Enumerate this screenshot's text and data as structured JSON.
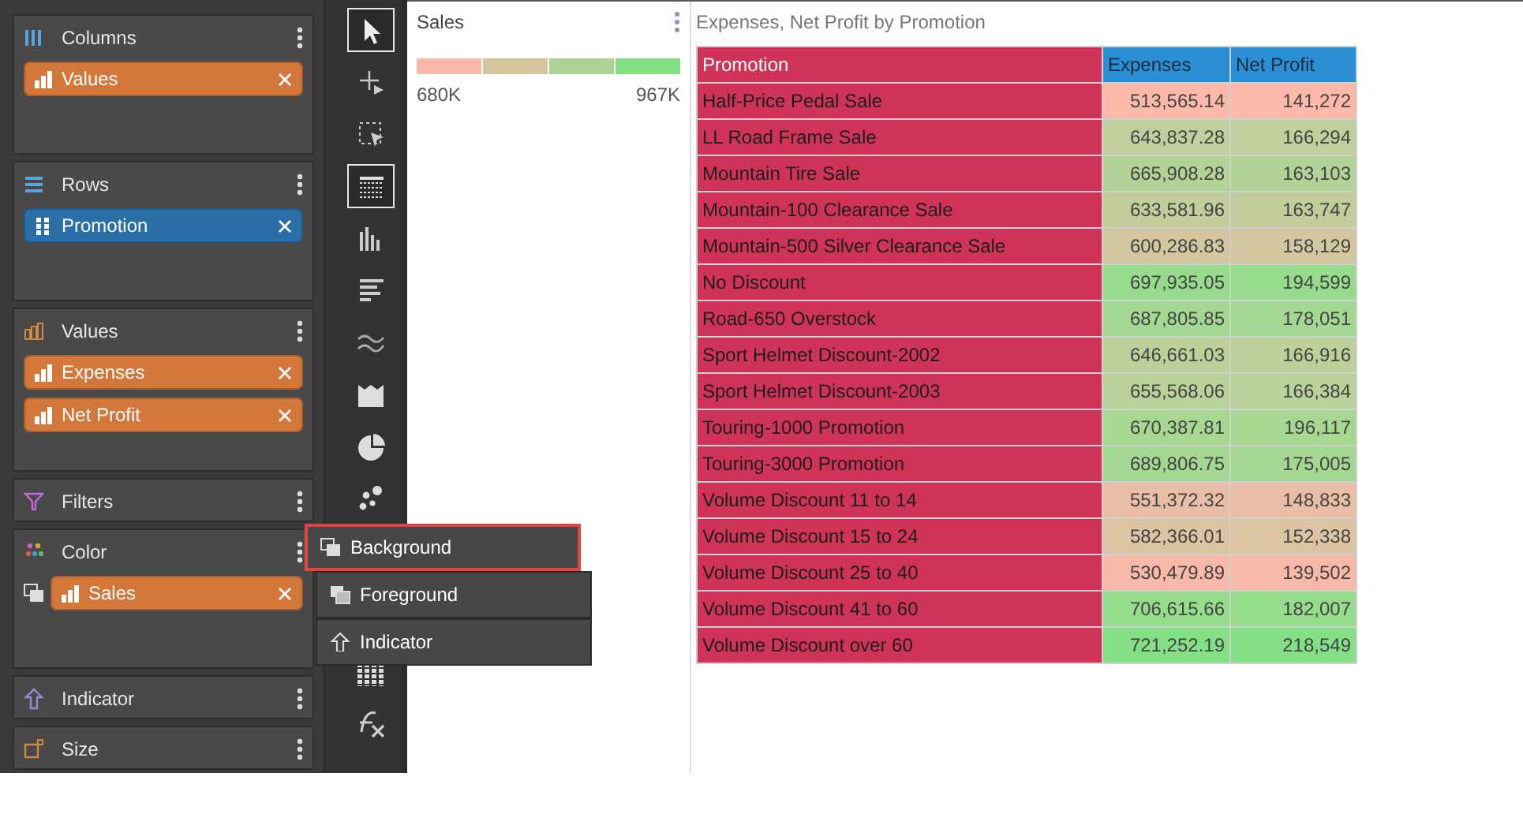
{
  "field_panels": [
    {
      "kind": "columns",
      "title": "Columns",
      "chips": [
        {
          "label": "Values",
          "color": "#d4773a",
          "kind": "measure"
        }
      ]
    },
    {
      "kind": "rows",
      "title": "Rows",
      "chips": [
        {
          "label": "Promotion",
          "color": "#2a6fa8",
          "kind": "dimension"
        }
      ]
    },
    {
      "kind": "values",
      "title": "Values",
      "chips": [
        {
          "label": "Expenses",
          "color": "#d4773a",
          "kind": "measure"
        },
        {
          "label": "Net Profit",
          "color": "#d4773a",
          "kind": "measure"
        }
      ]
    },
    {
      "kind": "filters",
      "title": "Filters"
    },
    {
      "kind": "color",
      "title": "Color",
      "chips": [
        {
          "label": "Sales",
          "color": "#d4773a",
          "kind": "measure"
        }
      ]
    },
    {
      "kind": "indicator",
      "title": "Indicator"
    },
    {
      "kind": "size",
      "title": "Size"
    }
  ],
  "toolbar": [
    {
      "kind": "pointer",
      "selected": true
    },
    {
      "kind": "add",
      "selected": false
    },
    {
      "kind": "select",
      "selected": false
    },
    {
      "kind": "table",
      "selected": true
    },
    {
      "kind": "columns",
      "selected": false
    },
    {
      "kind": "bars",
      "selected": false
    },
    {
      "kind": "line",
      "selected": false
    },
    {
      "kind": "area",
      "selected": false
    },
    {
      "kind": "pie",
      "selected": false
    },
    {
      "kind": "scatter",
      "selected": false
    },
    {
      "kind": "grid",
      "selected": false
    },
    {
      "kind": "formula",
      "selected": false
    }
  ],
  "color_menu": [
    {
      "kind": "background",
      "label": "Background",
      "selected": true
    },
    {
      "kind": "foreground",
      "label": "Foreground",
      "selected": false
    },
    {
      "kind": "indicator",
      "label": "Indicator",
      "selected": false
    }
  ],
  "legend": {
    "title": "Sales",
    "segments": [
      {
        "color": "#fbb8a8"
      },
      {
        "color": "#d5c59e"
      },
      {
        "color": "#acd295"
      },
      {
        "color": "#84df83"
      }
    ],
    "min": "680K",
    "max": "967K"
  },
  "table": {
    "title": "Expenses, Net Profit by Promotion",
    "columns": [
      "Promotion",
      "Expenses",
      "Net Profit"
    ],
    "rows": [
      {
        "cells": [
          "Half-Price Pedal Sale",
          "513,565.14",
          "141,272"
        ],
        "color": "#fcb8a8"
      },
      {
        "cells": [
          "LL Road Frame Sale",
          "643,837.28",
          "166,294"
        ],
        "color": "#c0cf9c"
      },
      {
        "cells": [
          "Mountain Tire Sale",
          "665,908.28",
          "163,103"
        ],
        "color": "#b3d297"
      },
      {
        "cells": [
          "Mountain-100 Clearance Sale",
          "633,581.96",
          "163,747"
        ],
        "color": "#c3cc9b"
      },
      {
        "cells": [
          "Mountain-500 Silver Clearance Sale",
          "600,286.83",
          "158,129"
        ],
        "color": "#d2c79e"
      },
      {
        "cells": [
          "No Discount",
          "697,935.05",
          "194,599"
        ],
        "color": "#97dc8c"
      },
      {
        "cells": [
          "Road-650 Overstock",
          "687,805.85",
          "178,051"
        ],
        "color": "#a2d891"
      },
      {
        "cells": [
          "Sport Helmet Discount-2002",
          "646,661.03",
          "166,916"
        ],
        "color": "#bcd09a"
      },
      {
        "cells": [
          "Sport Helmet Discount-2003",
          "655,568.06",
          "166,384"
        ],
        "color": "#b8d29a"
      },
      {
        "cells": [
          "Touring-1000 Promotion",
          "670,387.81",
          "196,117"
        ],
        "color": "#a6d892"
      },
      {
        "cells": [
          "Touring-3000 Promotion",
          "689,806.75",
          "175,005"
        ],
        "color": "#a3d892"
      },
      {
        "cells": [
          "Volume Discount 11 to 14",
          "551,372.32",
          "148,833"
        ],
        "color": "#eabda6"
      },
      {
        "cells": [
          "Volume Discount 15 to 24",
          "582,366.01",
          "152,338"
        ],
        "color": "#dcc3a2"
      },
      {
        "cells": [
          "Volume Discount 25 to 40",
          "530,479.89",
          "139,502"
        ],
        "color": "#f7b9a8"
      },
      {
        "cells": [
          "Volume Discount 41 to 60",
          "706,615.66",
          "182,007"
        ],
        "color": "#95dc8b"
      },
      {
        "cells": [
          "Volume Discount over 60",
          "721,252.19",
          "218,549"
        ],
        "color": "#83e084"
      }
    ]
  }
}
